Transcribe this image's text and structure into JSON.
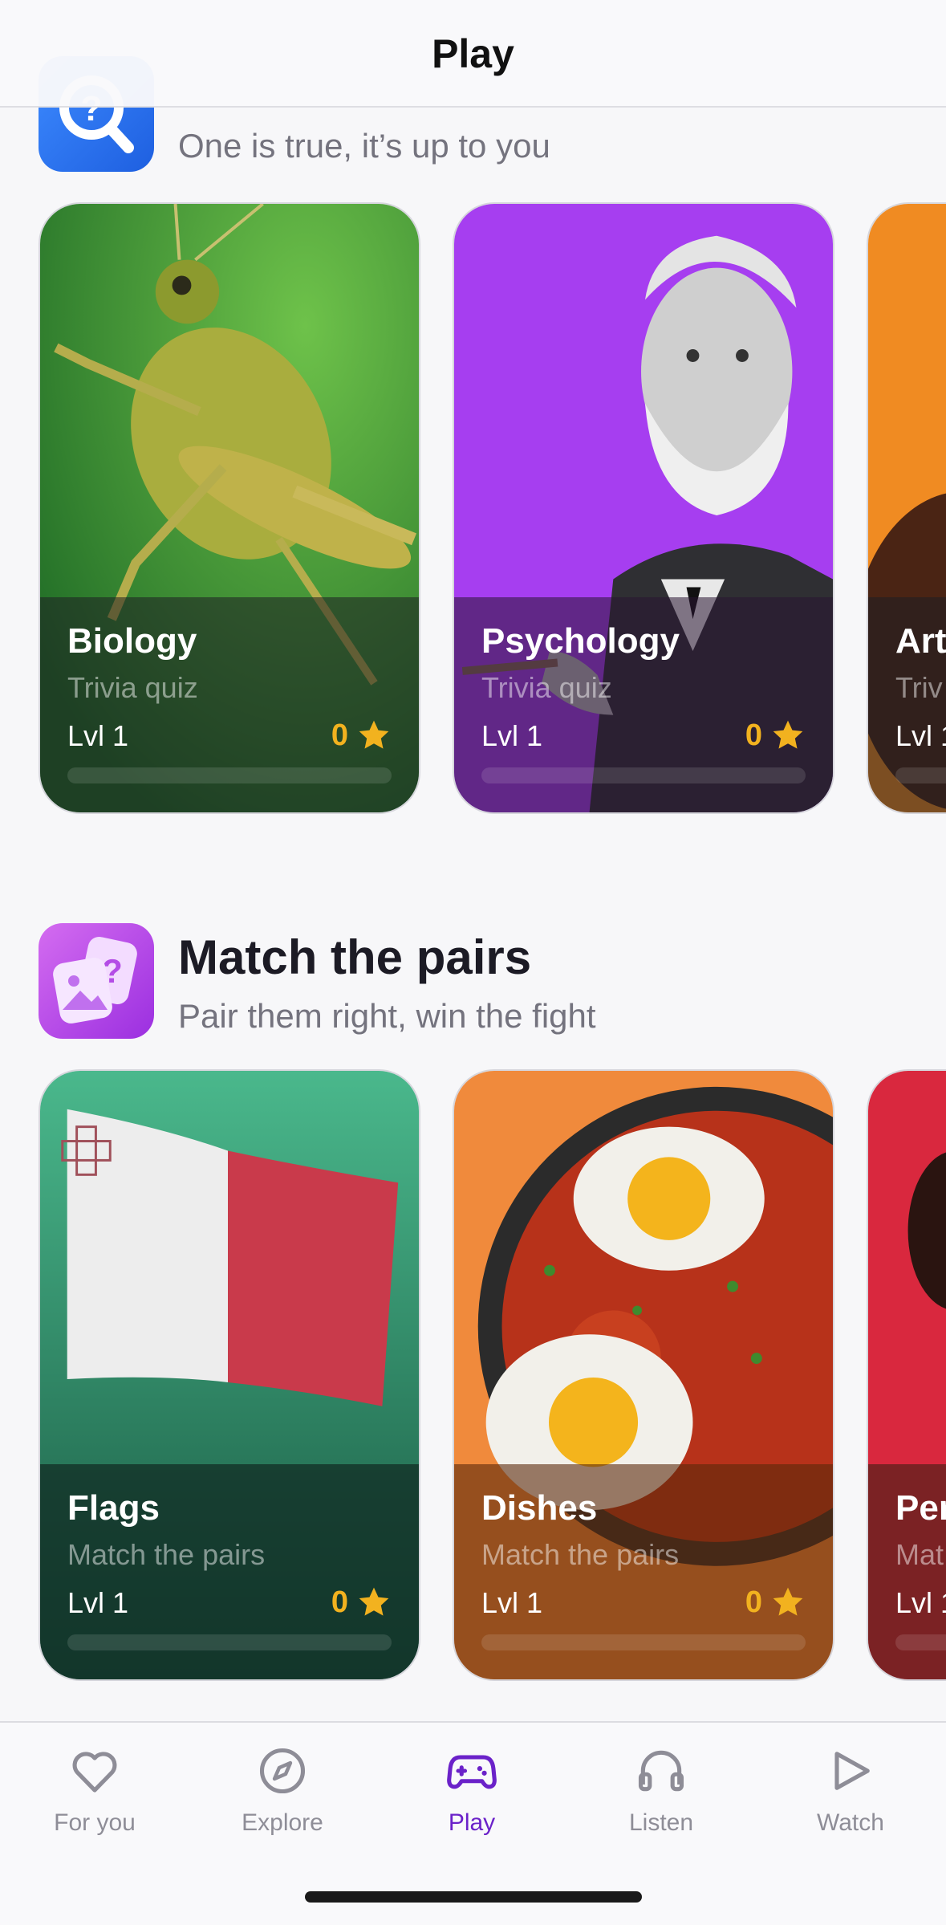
{
  "header": {
    "title": "Play"
  },
  "section_trivia": {
    "subtitle": "One is true, it’s up to you",
    "cards": [
      {
        "name": "Biology",
        "kind": "Trivia quiz",
        "level": "Lvl 1",
        "stars": "0",
        "progress": 0
      },
      {
        "name": "Psychology",
        "kind": "Trivia quiz",
        "level": "Lvl 1",
        "stars": "0",
        "progress": 0
      },
      {
        "name": "Art",
        "kind": "Triv",
        "level": "Lvl 1",
        "progress": 0
      }
    ]
  },
  "section_pairs": {
    "title": "Match the pairs",
    "subtitle": "Pair them right, win the fight",
    "cards": [
      {
        "name": "Flags",
        "kind": "Match the pairs",
        "level": "Lvl 1",
        "stars": "0",
        "progress": 0
      },
      {
        "name": "Dishes",
        "kind": "Match the pairs",
        "level": "Lvl 1",
        "stars": "0",
        "progress": 0
      },
      {
        "name": "Per",
        "kind": "Mat",
        "level": "Lvl 1",
        "progress": 0
      }
    ]
  },
  "nav": {
    "items": [
      {
        "label": "For you",
        "icon": "heart-icon"
      },
      {
        "label": "Explore",
        "icon": "compass-icon"
      },
      {
        "label": "Play",
        "icon": "gamepad-icon",
        "active": true
      },
      {
        "label": "Listen",
        "icon": "headphones-icon"
      },
      {
        "label": "Watch",
        "icon": "play-triangle-icon"
      }
    ]
  },
  "colors": {
    "accent": "#6b22c9",
    "star": "#f2b21f",
    "background": "#f7f7f9"
  }
}
